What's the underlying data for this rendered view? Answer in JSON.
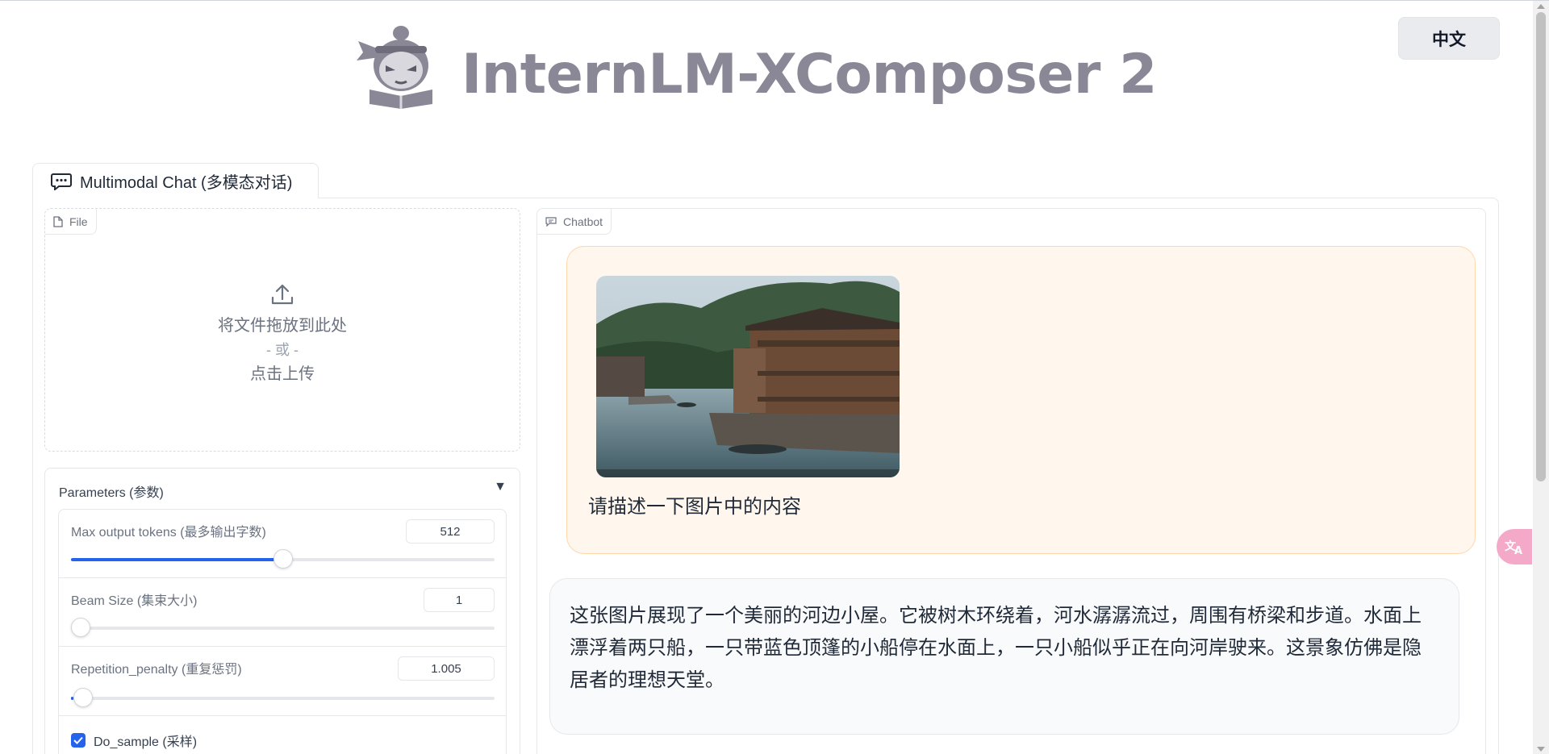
{
  "header": {
    "title": "InternLM-XComposer 2",
    "language_button": "中文"
  },
  "tabs": [
    {
      "label": "Multimodal Chat (多模态对话)",
      "icon": "chat-bubble-icon"
    }
  ],
  "file_upload": {
    "label": "File",
    "drop_text": "将文件拖放到此处",
    "or_text": "- 或 -",
    "click_text": "点击上传"
  },
  "parameters": {
    "title": "Parameters (参数)",
    "toggle": "▼",
    "max_tokens": {
      "label": "Max output tokens (最多输出字数)",
      "value": "512",
      "fraction": 0.5
    },
    "beam_size": {
      "label": "Beam Size (集束大小)",
      "value": "1",
      "fraction": 0.0
    },
    "repetition_penalty": {
      "label": "Repetition_penalty (重复惩罚)",
      "value": "1.005",
      "fraction": 0.005
    },
    "do_sample": {
      "label": "Do_sample (采样)",
      "checked": true
    }
  },
  "chatbot": {
    "label": "Chatbot",
    "user_message": "请描述一下图片中的内容",
    "bot_message": "这张图片展现了一个美丽的河边小屋。它被树木环绕着，河水潺潺流过，周围有桥梁和步道。水面上漂浮着两只船，一只带蓝色顶篷的小船停在水面上，一只小船似乎正在向河岸驶来。这景象仿佛是隐居者的理想天堂。"
  },
  "colors": {
    "accent": "#2563eb",
    "title_gray": "#8a8796",
    "user_bubble": "#fff7ed",
    "user_bubble_border": "#fed7aa",
    "bot_bubble": "#f9fafb"
  }
}
